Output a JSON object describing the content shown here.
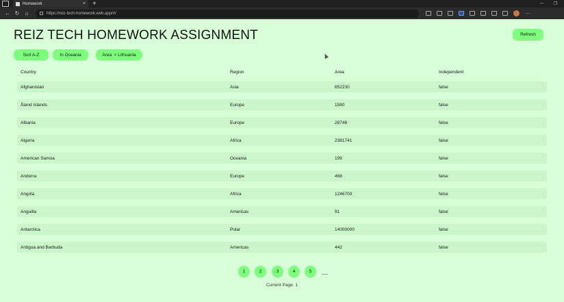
{
  "browser": {
    "tab_title": "Homework",
    "url": "https://reiz-tech-homework.web.app/#/"
  },
  "page": {
    "title": "REIZ TECH HOMEWORK ASSIGNMENT",
    "refresh_label": "Refresh",
    "filters": {
      "sort_label": "Sort A-Z",
      "oceania_label": "In Oceania",
      "area_label": "Area: < Lithuania"
    }
  },
  "table": {
    "headers": {
      "country": "Country",
      "region": "Region",
      "area": "Area",
      "independent": "Independent"
    },
    "rows": [
      {
        "country": "Afghanistan",
        "region": "Asia",
        "area": "652230",
        "independent": "false"
      },
      {
        "country": "Åland Islands",
        "region": "Europe",
        "area": "1580",
        "independent": "false"
      },
      {
        "country": "Albania",
        "region": "Europe",
        "area": "28748",
        "independent": "false"
      },
      {
        "country": "Algeria",
        "region": "Africa",
        "area": "2381741",
        "independent": "false"
      },
      {
        "country": "American Samoa",
        "region": "Oceania",
        "area": "199",
        "independent": "false"
      },
      {
        "country": "Andorra",
        "region": "Europe",
        "area": "468",
        "independent": "false"
      },
      {
        "country": "Angola",
        "region": "Africa",
        "area": "1246700",
        "independent": "false"
      },
      {
        "country": "Anguilla",
        "region": "Americas",
        "area": "91",
        "independent": "false"
      },
      {
        "country": "Antarctica",
        "region": "Polar",
        "area": "14000000",
        "independent": "false"
      },
      {
        "country": "Antigua and Barbuda",
        "region": "Americas",
        "area": "442",
        "independent": "false"
      }
    ]
  },
  "pagination": {
    "pages": [
      "1",
      "2",
      "3",
      "4",
      "5"
    ],
    "current_label": "Current Page: 1"
  },
  "colors": {
    "background": "#d9ffd9",
    "button": "#7dff7d",
    "row": "#cbf5cb"
  }
}
